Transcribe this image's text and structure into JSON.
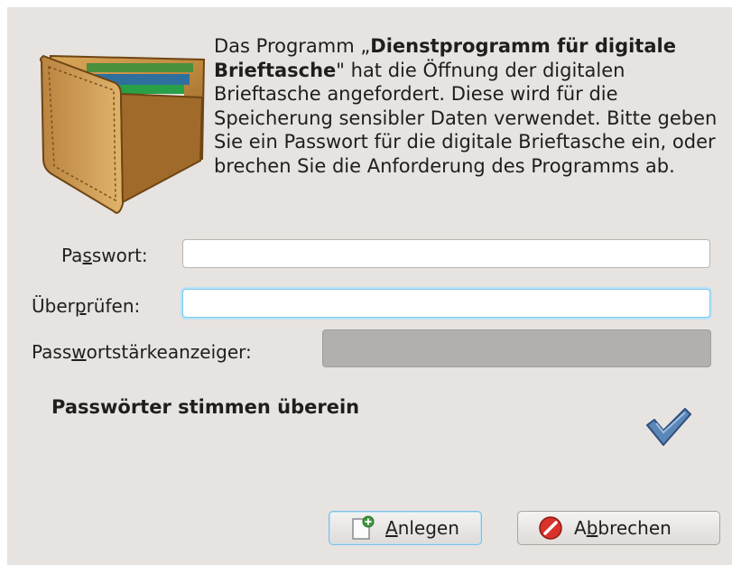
{
  "dialog": {
    "message_prefix": "Das Programm „",
    "program_name": "Dienstprogramm für digitale Brieftasche",
    "message_suffix": "\" hat die Öffnung der digitalen Brieftasche angefordert. Diese wird für die Speicherung sensibler Daten verwendet. Bitte geben Sie ein Passwort für die digitale Brieftasche ein, oder brechen Sie die Anforderung des Programms ab."
  },
  "form": {
    "password_label_pre": "Pa",
    "password_label_key": "s",
    "password_label_post": "swort:",
    "password_value": "",
    "verify_label_pre": "Über",
    "verify_label_key": "p",
    "verify_label_post": "rüfen:",
    "verify_value": "",
    "strength_label_pre": "Pass",
    "strength_label_key": "w",
    "strength_label_post": "ortstärkeanzeiger:",
    "strength_percent": 0
  },
  "status": {
    "match_text": "Passwörter stimmen überein",
    "icon": "checkmark-icon"
  },
  "buttons": {
    "create_key": "A",
    "create_rest": "nlegen",
    "cancel_pre": "A",
    "cancel_key": "b",
    "cancel_post": "brechen"
  },
  "colors": {
    "dialog_background": "#e6e3e1",
    "focus_blue": "#7cc8ee",
    "check_blue": "#5a86b8",
    "cancel_red": "#d9322a"
  }
}
